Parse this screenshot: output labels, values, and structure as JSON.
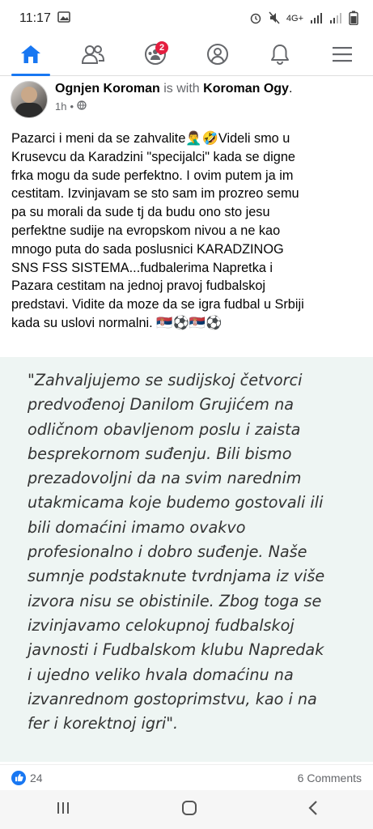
{
  "status_bar": {
    "time": "11:17",
    "network": "4G+"
  },
  "nav": {
    "groups_badge": "2"
  },
  "post": {
    "author": "Ognjen Koroman",
    "with_text": "is with",
    "tagged": "Koroman Ogy",
    "period": ".",
    "time": "1h",
    "separator": "•",
    "text": "Pazarci i meni da se zahvalite🤦‍♂️🤣Videli smo u\nKrusevcu da Karadzini \"specijalci\" kada se digne\nfrka mogu da sude perfektno. I ovim putem ja im\ncestitam. Izvinjavam se sto sam im prozreo semu\npa su morali da sude tj da budu ono sto jesu\nperfektne sudije na evropskom nivou a ne kao\nmnogo puta do sada poslusnici KARADZINOG\nSNS FSS SISTEMA...fudbalerima Napretka i\nPazara cestitam na jednoj pravoj fudbalskoj\npredstavi. Vidite da moze da se igra fudbal u Srbiji\nkada su uslovi normalni. 🇷🇸⚽🇷🇸⚽",
    "quote": "\"Zahvaljujemo se sudijskoj četvorci\npredvođenoj Danilom Grujićem na\nodličnom obavljenom poslu i zaista\nbesprekornom suđenju. Bili bismo\nprezadovoljni da na svim narednim\nutakmicama koje budemo gostovali ili\nbili domaćini imamo ovakvo\nprofesionalno i dobro suđenje. Naše\nsumnje podstaknute tvrdnjama iz više\nizvora nisu se obistinile. Zbog toga se\nizvinjavamo celokupnoj fudbalskoj\njavnosti i Fudbalskom klubu Napredak\ni ujedno veliko hvala domaćinu na\nizvanrednom gostoprimstvu, kao i na\nfer i korektnoj igri\".",
    "likes": "24",
    "comments": "6 Comments"
  },
  "colors": {
    "accent": "#1877f2",
    "badge": "#e41e3f",
    "quote_bg": "#eef5f3"
  }
}
